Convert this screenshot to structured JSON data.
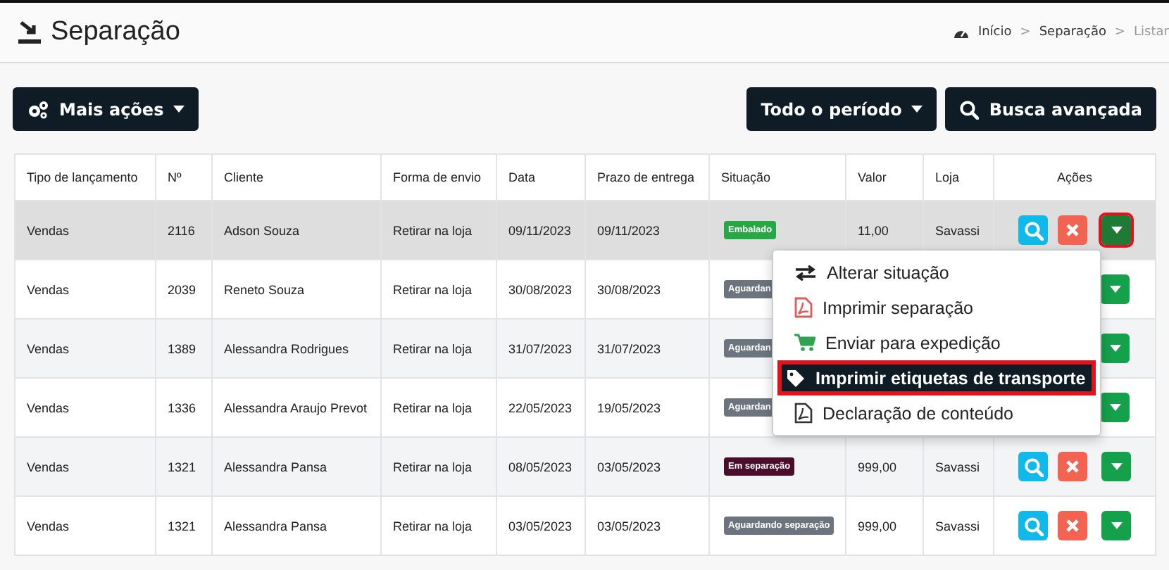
{
  "page": {
    "title": "Separação",
    "breadcrumb": [
      {
        "kind": "link",
        "label": "Início"
      },
      {
        "kind": "separator",
        "label": ">"
      },
      {
        "kind": "link",
        "label": "Separação"
      },
      {
        "kind": "separator",
        "label": ">"
      },
      {
        "kind": "current",
        "label": "Listar"
      }
    ]
  },
  "toolbar": {
    "left": [
      {
        "label": "Mais ações",
        "caret": true
      }
    ],
    "right": [
      {
        "label": "Todo o período",
        "caret": true
      },
      {
        "label": "Busca avançada",
        "caret": false
      }
    ]
  },
  "table": {
    "columns": [
      "Tipo de lançamento",
      "Nº",
      "Cliente",
      "Forma de envio",
      "Data",
      "Prazo de entrega",
      "Situação",
      "Valor",
      "Loja",
      "Ações"
    ],
    "rows": [
      {
        "selected": true,
        "cells": [
          "Vendas",
          "2116",
          "Adson Souza",
          "Retirar na loja",
          "09/11/2023",
          "09/11/2023"
        ],
        "status": {
          "label": "Embalado",
          "color": "#28a745"
        },
        "valor": "11,00",
        "loja": "Savassi",
        "menu_open": true
      },
      {
        "selected": false,
        "cells": [
          "Vendas",
          "2039",
          "Reneto Souza",
          "Retirar na loja",
          "30/08/2023",
          "30/08/2023"
        ],
        "status": {
          "label": "Aguardan",
          "color": "#6c757d"
        },
        "menu_open": false
      },
      {
        "selected": false,
        "cells": [
          "Vendas",
          "1389",
          "Alessandra Rodrigues",
          "Retirar na loja",
          "31/07/2023",
          "31/07/2023"
        ],
        "status": {
          "label": "Aguardan",
          "color": "#6c757d"
        },
        "menu_open": false
      },
      {
        "selected": false,
        "cells": [
          "Vendas",
          "1336",
          "Alessandra Araujo Prevot",
          "Retirar na loja",
          "22/05/2023",
          "19/05/2023"
        ],
        "status": {
          "label": "Aguardan",
          "color": "#6c757d"
        },
        "menu_open": false
      },
      {
        "selected": false,
        "cells": [
          "Vendas",
          "1321",
          "Alessandra Pansa",
          "Retirar na loja",
          "08/05/2023",
          "03/05/2023"
        ],
        "status": {
          "label": "Em separação",
          "color": "#4a0d2b"
        },
        "valor": "999,00",
        "loja": "Savassi",
        "menu_open": false
      },
      {
        "selected": false,
        "cells": [
          "Vendas",
          "1321",
          "Alessandra Pansa",
          "Retirar na loja",
          "03/05/2023",
          "03/05/2023"
        ],
        "status": {
          "label": "Aguardando separação",
          "color": "#6c757d"
        },
        "valor": "999,00",
        "loja": "Savassi",
        "menu_open": false
      }
    ]
  },
  "menu": {
    "items": [
      {
        "label": "Alterar situação",
        "selected": false
      },
      {
        "label": "Imprimir separação",
        "selected": false
      },
      {
        "label": "Enviar para expedição",
        "selected": false
      },
      {
        "label": "Imprimir etiquetas de transporte",
        "selected": true
      },
      {
        "label": "Declaração de conteúdo",
        "selected": false
      }
    ]
  }
}
